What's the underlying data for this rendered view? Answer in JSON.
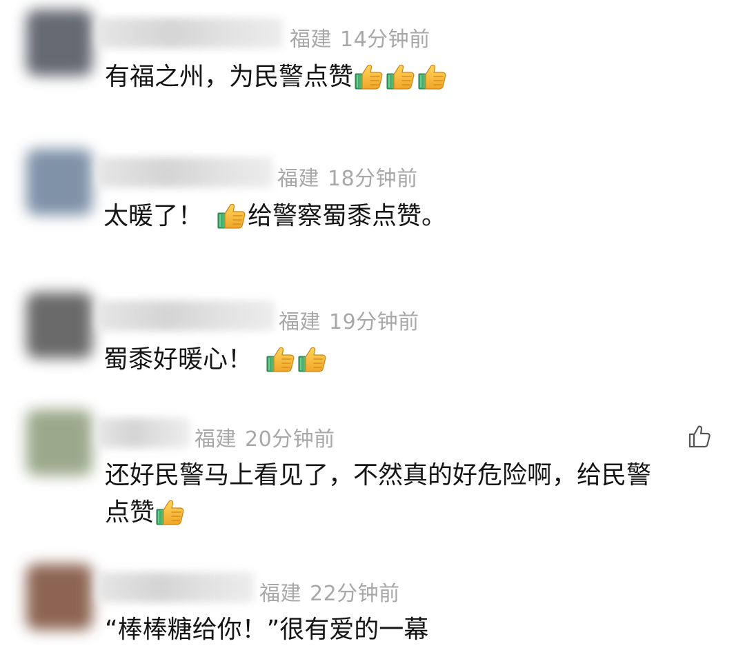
{
  "comments": [
    {
      "location": "福建",
      "time": "14分钟前",
      "parts": [
        "有福之州，为民警点赞"
      ],
      "thumbs_after": 3,
      "avatar_color": "#4a4f5a"
    },
    {
      "location": "福建",
      "time": "18分钟前",
      "parts_before": "太暖了！",
      "parts_after": "给警察蜀黍点赞。",
      "avatar_color": "#6a7f9a"
    },
    {
      "location": "福建",
      "time": "19分钟前",
      "parts": [
        "蜀黍好暖心！"
      ],
      "thumbs_after": 2,
      "avatar_color": "#505050"
    },
    {
      "location": "福建",
      "time": "20分钟前",
      "line1": "还好民警马上看见了，不然真的好危险啊，给民警",
      "line2": "点赞",
      "thumbs_after": 1,
      "avatar_color": "#8a9a78"
    },
    {
      "location": "福建",
      "time": "22分钟前",
      "parts": [
        "“棒棒糖给你！”很有爱的一幕"
      ],
      "avatar_color": "#7a4a36"
    }
  ],
  "colors": {
    "meta_text": "#a8a8a8",
    "body_text": "#151515",
    "thumb_yellow": "#f2b83a",
    "thumb_sleeve": "#3aa86a"
  },
  "icons": {
    "thumbs_up_emoji": "thumbs-up-icon",
    "like_button": "like-icon"
  }
}
